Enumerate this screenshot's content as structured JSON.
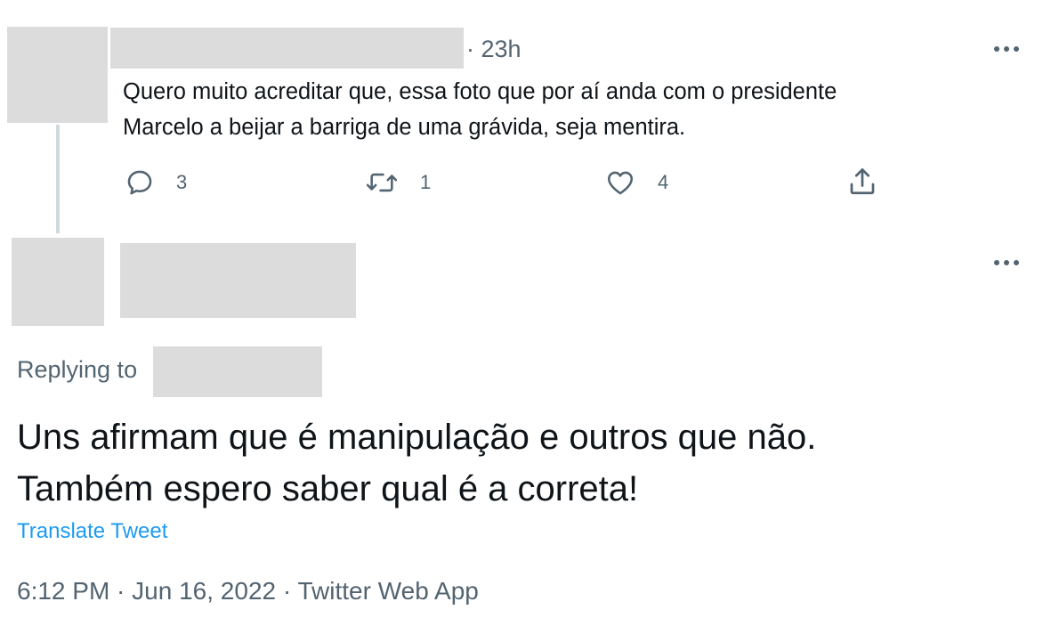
{
  "reply_tweet": {
    "timestamp": "· 23h",
    "text_line1": "Quero muito acreditar que, essa foto que por aí anda com o presidente",
    "text_line2": "Marcelo a beijar a barriga de uma grávida, seja mentira.",
    "actions": {
      "reply_count": "3",
      "retweet_count": "1",
      "like_count": "4"
    }
  },
  "main_tweet": {
    "replying_to_label": "Replying to",
    "text_line1": "Uns afirmam que é manipulação e outros que não.",
    "text_line2": "Também espero saber qual é a correta!",
    "translate_label": "Translate Tweet",
    "time": "6:12 PM",
    "date": "Jun 16, 2022",
    "source": "Twitter Web App",
    "separator": " · "
  },
  "colors": {
    "text_primary": "#0f1419",
    "text_secondary": "#536471",
    "link": "#1d9bf0",
    "redaction": "#dcdcdc",
    "thread_line": "#cfd9de"
  },
  "icons": [
    "more-icon",
    "reply-icon",
    "retweet-icon",
    "like-icon",
    "share-icon"
  ]
}
